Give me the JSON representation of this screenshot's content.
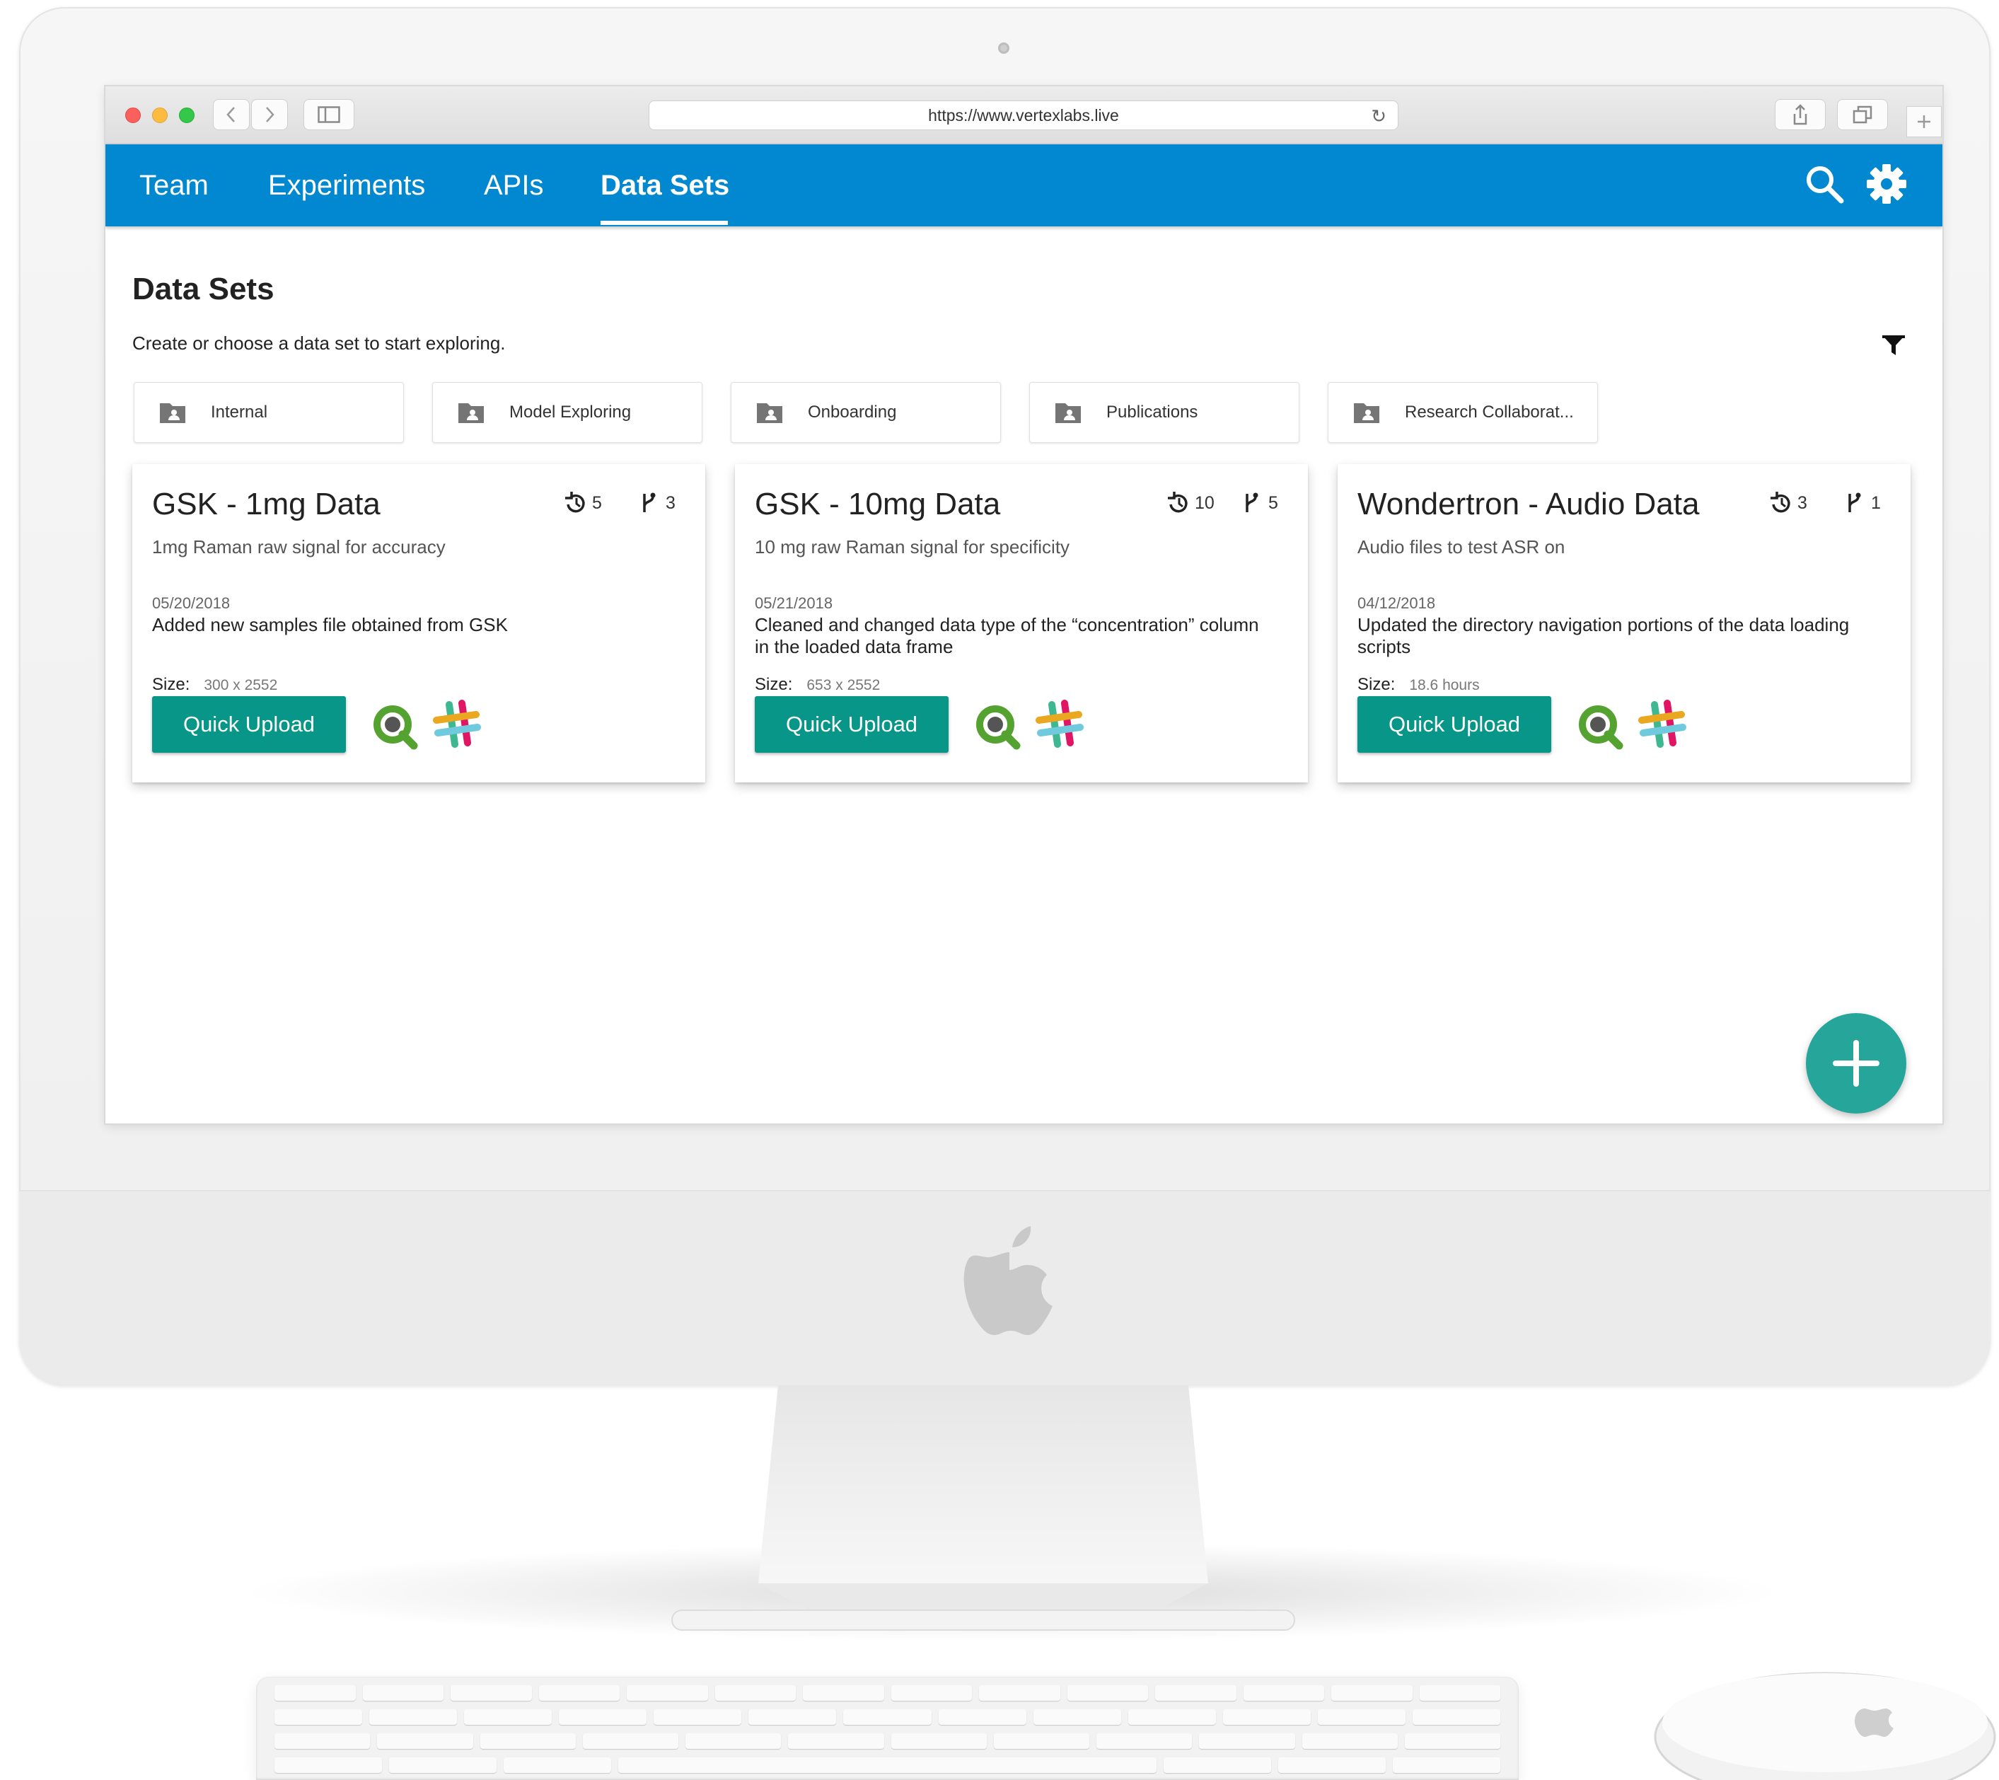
{
  "browser": {
    "url": "https://www.vertexlabs.live"
  },
  "nav": {
    "tabs": [
      {
        "label": "Team"
      },
      {
        "label": "Experiments"
      },
      {
        "label": "APIs"
      },
      {
        "label": "Data Sets",
        "active": true
      }
    ],
    "icons": [
      "search-icon",
      "settings-gear-icon"
    ]
  },
  "page": {
    "title": "Data Sets",
    "subtitle": "Create or choose a data set to start exploring."
  },
  "folders": [
    {
      "label": "Internal"
    },
    {
      "label": "Model Exploring"
    },
    {
      "label": "Onboarding"
    },
    {
      "label": "Publications"
    },
    {
      "label": "Research Collaborat..."
    }
  ],
  "cards": [
    {
      "title": "GSK - 1mg Data",
      "description": "1mg Raman raw signal for accuracy",
      "history_count": "5",
      "branch_count": "3",
      "date": "05/20/2018",
      "message": "Added new samples file obtained from GSK",
      "size_label": "Size:",
      "size_value": "300 x 2552",
      "button_label": "Quick Upload"
    },
    {
      "title": "GSK - 10mg Data",
      "description": "10 mg raw Raman signal for specificity",
      "history_count": "10",
      "branch_count": "5",
      "date": "05/21/2018",
      "message": "Cleaned and changed data type of the “concentration” column in the loaded data frame",
      "size_label": "Size:",
      "size_value": "653 x 2552",
      "button_label": "Quick Upload"
    },
    {
      "title": "Wondertron - Audio Data",
      "description": "Audio files to test ASR on",
      "history_count": "3",
      "branch_count": "1",
      "date": "04/12/2018",
      "message": "Updated the directory navigation portions of the data loading scripts",
      "size_label": "Size:",
      "size_value": "18.6 hours",
      "button_label": "Quick Upload"
    }
  ],
  "colors": {
    "header": "#0288d1",
    "button": "#079687",
    "fab": "#26a69a",
    "qlik_green": "#54a230",
    "qlik_gray": "#555555"
  }
}
